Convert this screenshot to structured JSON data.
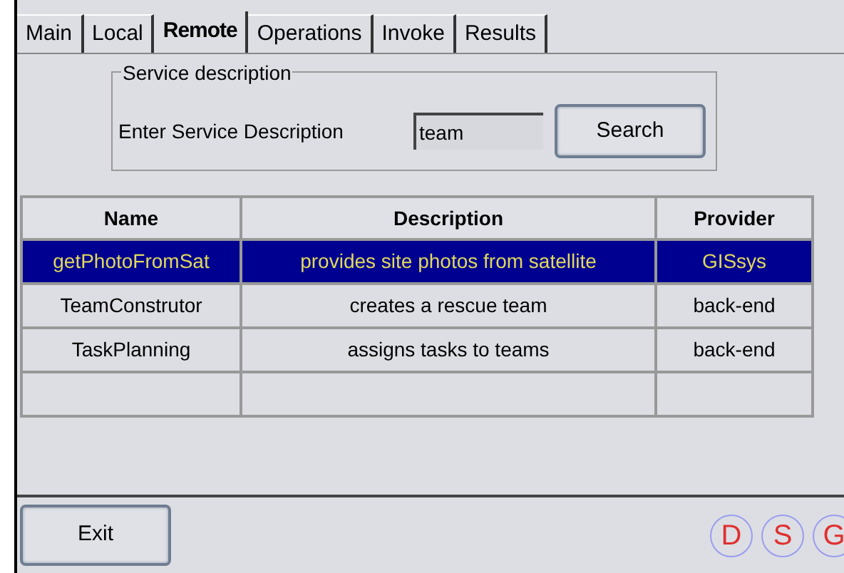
{
  "tabs": [
    {
      "label": "Main",
      "selected": false
    },
    {
      "label": "Local",
      "selected": false
    },
    {
      "label": "Remote",
      "selected": true
    },
    {
      "label": "Operations",
      "selected": false
    },
    {
      "label": "Invoke",
      "selected": false
    },
    {
      "label": "Results",
      "selected": false
    }
  ],
  "service_description": {
    "title": "Service description",
    "label": "Enter Service Description",
    "value": "team",
    "button": "Search"
  },
  "table": {
    "columns": [
      "Name",
      "Description",
      "Provider"
    ],
    "rows": [
      {
        "cells": [
          "getPhotoFromSat",
          "provides site photos from satellite",
          "GISsys"
        ],
        "selected": true
      },
      {
        "cells": [
          "TeamConstrutor",
          "creates a rescue team",
          "back-end"
        ],
        "selected": false
      },
      {
        "cells": [
          "TaskPlanning",
          "assigns tasks to teams",
          "back-end"
        ],
        "selected": false
      }
    ]
  },
  "exit_button": "Exit",
  "logo": [
    "D",
    "S",
    "G"
  ]
}
